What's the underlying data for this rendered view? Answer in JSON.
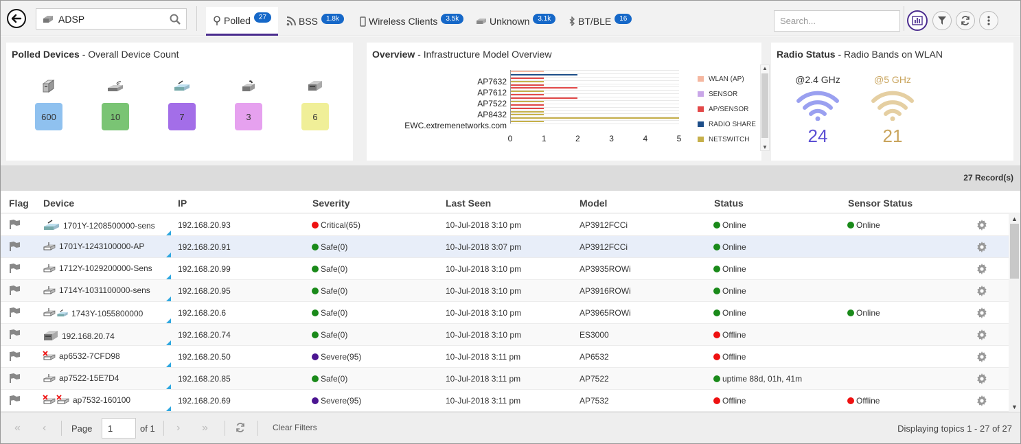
{
  "site": {
    "label": "ADSP"
  },
  "tabs": [
    {
      "label": "Polled",
      "count": "27"
    },
    {
      "label": "BSS",
      "count": "1.8k"
    },
    {
      "label": "Wireless Clients",
      "count": "3.5k"
    },
    {
      "label": "Unknown",
      "count": "3.1k"
    },
    {
      "label": "BT/BLE",
      "count": "16"
    }
  ],
  "search": {
    "placeholder": "Search..."
  },
  "polled_panel": {
    "title": "Polled Devices",
    "subtitle": " - Overall Device Count",
    "counts": [
      {
        "value": "600",
        "color": "#8fc1ef",
        "icon": "server-icon"
      },
      {
        "value": "10",
        "color": "#7ac474",
        "icon": "wireless-ap-icon"
      },
      {
        "value": "7",
        "color": "#a36ee8",
        "icon": "sensor-icon"
      },
      {
        "value": "3",
        "color": "#e6a1ef",
        "icon": "ap-sensor-icon"
      },
      {
        "value": "6",
        "color": "#f0ef98",
        "icon": "switch-icon"
      }
    ]
  },
  "overview_panel": {
    "title": "Overview",
    "subtitle": " - Infrastructure Model Overview"
  },
  "chart_data": {
    "type": "bar",
    "orientation": "horizontal",
    "categories": [
      "AP7632",
      "AP7612",
      "AP7522",
      "AP8432",
      "EWC.extremenetworks.com"
    ],
    "xlim": [
      0,
      5
    ],
    "xticks": [
      "0",
      "1",
      "2",
      "3",
      "4",
      "5"
    ],
    "series": [
      {
        "name": "WLAN (AP)",
        "color": "#f5b7a0"
      },
      {
        "name": "SENSOR",
        "color": "#c9a6e8"
      },
      {
        "name": "AP/SENSOR",
        "color": "#e24848"
      },
      {
        "name": "RADIO SHARE",
        "color": "#1d4e89"
      },
      {
        "name": "NETSWITCH",
        "color": "#c6b04a"
      }
    ],
    "bars": [
      {
        "color": "#f5b7a0",
        "value": 1
      },
      {
        "color": "#1d4e89",
        "value": 2
      },
      {
        "color": "#e24848",
        "value": 1
      },
      {
        "color": "#c6b04a",
        "value": 1
      },
      {
        "color": "#e24848",
        "value": 1
      },
      {
        "color": "#e24848",
        "value": 2
      },
      {
        "color": "#c6b04a",
        "value": 1
      },
      {
        "color": "#e24848",
        "value": 1
      },
      {
        "color": "#e24848",
        "value": 2
      },
      {
        "color": "#c6b04a",
        "value": 1
      },
      {
        "color": "#e24848",
        "value": 1
      },
      {
        "color": "#e24848",
        "value": 1
      },
      {
        "color": "#c6b04a",
        "value": 1
      },
      {
        "color": "#c6b04a",
        "value": 1
      },
      {
        "color": "#c6b04a",
        "value": 5
      },
      {
        "color": "#c6b04a",
        "value": 1
      }
    ],
    "legend": "right",
    "grid": true
  },
  "radio_panel": {
    "title": "Radio Status",
    "subtitle": " - Radio Bands on WLAN",
    "bands": [
      {
        "label": "@2.4 GHz",
        "value": "24",
        "color": "#5b4fd4",
        "wifi_color": "#9aa0f0"
      },
      {
        "label": "@5 GHz",
        "value": "21",
        "color": "#c9a45c",
        "wifi_color": "#e5cfa2"
      }
    ]
  },
  "records": {
    "label": "27 Record(s)"
  },
  "table": {
    "headers": [
      "Flag",
      "Device",
      "IP",
      "Severity",
      "Last Seen",
      "Model",
      "Status",
      "Sensor Status"
    ],
    "rows": [
      {
        "device": "1701Y-1208500000-sens",
        "icon": "sensor-icon",
        "ip": "192.168.20.93",
        "severity": "Critical(65)",
        "sev_color": "#ee1111",
        "last_seen": "10-Jul-2018 3:10 pm",
        "model": "AP3912FCCi",
        "status": "Online",
        "status_color": "#1a8a1a",
        "sensor": "Online",
        "sensor_color": "#1a8a1a"
      },
      {
        "device": "1701Y-1243100000-AP",
        "icon": "access-point-icon",
        "ip": "192.168.20.91",
        "severity": "Safe(0)",
        "sev_color": "#1a8a1a",
        "last_seen": "10-Jul-2018 3:07 pm",
        "model": "AP3912FCCi",
        "status": "Online",
        "status_color": "#1a8a1a",
        "sensor": "",
        "sensor_color": ""
      },
      {
        "device": "1712Y-1029200000-Sens",
        "icon": "access-point-icon",
        "ip": "192.168.20.99",
        "severity": "Safe(0)",
        "sev_color": "#1a8a1a",
        "last_seen": "10-Jul-2018 3:10 pm",
        "model": "AP3935ROWi",
        "status": "Online",
        "status_color": "#1a8a1a",
        "sensor": "",
        "sensor_color": ""
      },
      {
        "device": "1714Y-1031100000-sens",
        "icon": "access-point-icon",
        "ip": "192.168.20.95",
        "severity": "Safe(0)",
        "sev_color": "#1a8a1a",
        "last_seen": "10-Jul-2018 3:10 pm",
        "model": "AP3916ROWi",
        "status": "Online",
        "status_color": "#1a8a1a",
        "sensor": "",
        "sensor_color": ""
      },
      {
        "device": "1743Y-1055800000",
        "icon": "ap-sensor-icon",
        "ip": "192.168.20.6",
        "severity": "Safe(0)",
        "sev_color": "#1a8a1a",
        "last_seen": "10-Jul-2018 3:10 pm",
        "model": "AP3965ROWi",
        "status": "Online",
        "status_color": "#1a8a1a",
        "sensor": "Online",
        "sensor_color": "#1a8a1a"
      },
      {
        "device": "192.168.20.74",
        "icon": "switch-icon",
        "ip": "192.168.20.74",
        "severity": "Safe(0)",
        "sev_color": "#1a8a1a",
        "last_seen": "10-Jul-2018 3:10 pm",
        "model": "ES3000",
        "status": "Offline",
        "status_color": "#ee1111",
        "sensor": "",
        "sensor_color": ""
      },
      {
        "device": "ap6532-7CFD98",
        "icon": "offline-ap-icon",
        "ip": "192.168.20.50",
        "severity": "Severe(95)",
        "sev_color": "#4b1591",
        "last_seen": "10-Jul-2018 3:11 pm",
        "model": "AP6532",
        "status": "Offline",
        "status_color": "#ee1111",
        "sensor": "",
        "sensor_color": ""
      },
      {
        "device": "ap7522-15E7D4",
        "icon": "access-point-icon",
        "ip": "192.168.20.85",
        "severity": "Safe(0)",
        "sev_color": "#1a8a1a",
        "last_seen": "10-Jul-2018 3:11 pm",
        "model": "AP7522",
        "status": "uptime 88d, 01h, 41m",
        "status_color": "#1a8a1a",
        "sensor": "",
        "sensor_color": ""
      },
      {
        "device": "ap7532-160100",
        "icon": "offline-ap-sensor-icon",
        "ip": "192.168.20.69",
        "severity": "Severe(95)",
        "sev_color": "#4b1591",
        "last_seen": "10-Jul-2018 3:11 pm",
        "model": "AP7532",
        "status": "Offline",
        "status_color": "#ee1111",
        "sensor": "Offline",
        "sensor_color": "#ee1111"
      }
    ]
  },
  "footer": {
    "page_label": "Page",
    "page_value": "1",
    "of_label": "of 1",
    "clear_filters": "Clear Filters",
    "displaying": "Displaying topics 1 - 27 of 27"
  }
}
